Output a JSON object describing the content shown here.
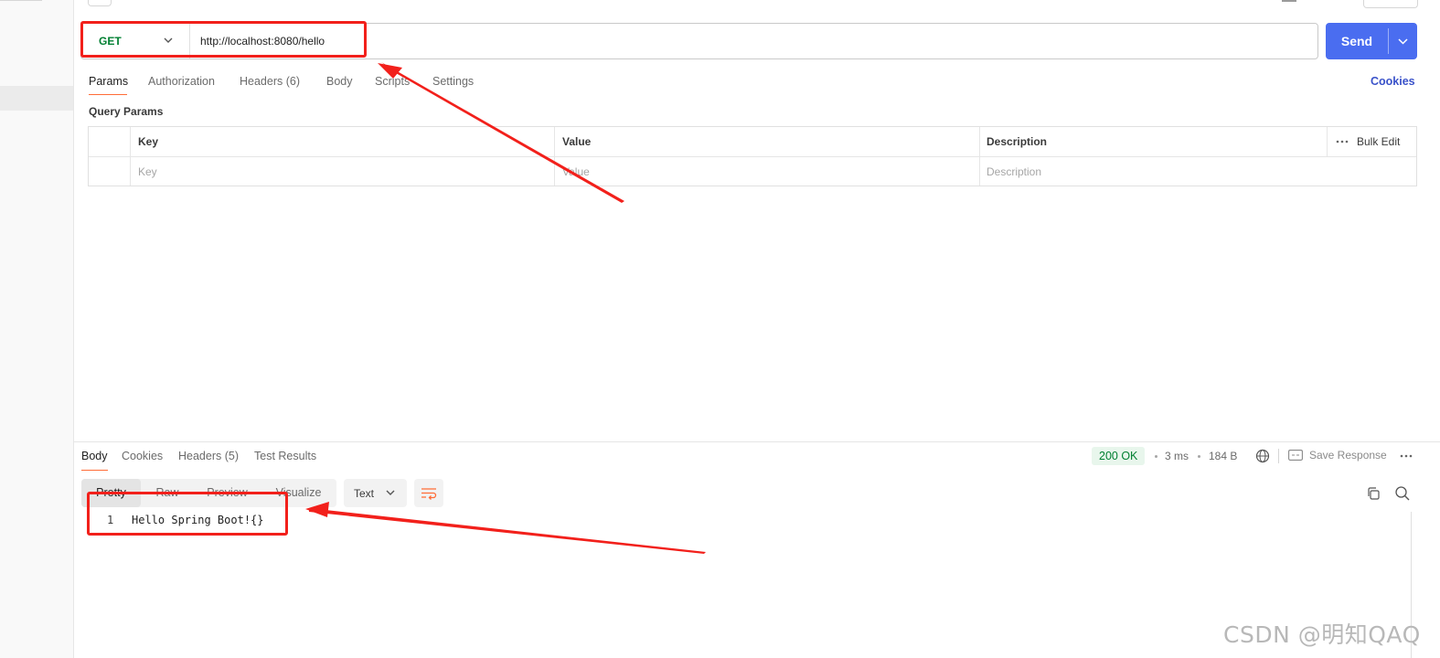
{
  "request": {
    "method": "GET",
    "url": "http://localhost:8080/hello",
    "send_label": "Send",
    "tabs": [
      {
        "label": "Params"
      },
      {
        "label": "Authorization"
      },
      {
        "label": "Headers (6)"
      },
      {
        "label": "Body"
      },
      {
        "label": "Scripts"
      },
      {
        "label": "Settings"
      }
    ],
    "cookies_label": "Cookies",
    "query_params_title": "Query Params",
    "table": {
      "headers": [
        "Key",
        "Value",
        "Description"
      ],
      "bulk_edit_label": "Bulk Edit",
      "placeholders": [
        "Key",
        "Value",
        "Description"
      ]
    }
  },
  "response": {
    "tabs": [
      {
        "label": "Body"
      },
      {
        "label": "Cookies"
      },
      {
        "label": "Headers (5)"
      },
      {
        "label": "Test Results"
      }
    ],
    "status": "200 OK",
    "time": "3 ms",
    "size": "184 B",
    "save_label": "Save Response",
    "views": [
      "Pretty",
      "Raw",
      "Preview",
      "Visualize"
    ],
    "format": "Text",
    "lines": [
      {
        "number": "1",
        "text": "Hello Spring Boot!{}"
      }
    ]
  },
  "colors": {
    "accent": "#ff6c37",
    "send_button": "#4a6df0",
    "method_get": "#007f31",
    "annotation": "#f2201b"
  },
  "watermark": "CSDN @明知QAQ"
}
